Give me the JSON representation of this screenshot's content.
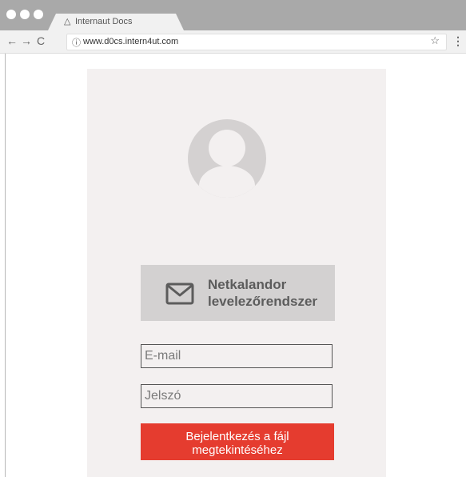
{
  "browser": {
    "tab_title": "Internaut Docs",
    "url": "www.d0cs.intern4ut.com",
    "icons": {
      "tab": "warning-triangle-icon",
      "back": "back-arrow-icon",
      "forward": "forward-arrow-icon",
      "reload": "reload-icon",
      "info": "info-icon",
      "bookmark": "star-icon",
      "menu": "kebab-menu-icon"
    }
  },
  "login": {
    "provider_label": "Netkalandor levelezőrendszer",
    "email_placeholder": "E-mail",
    "password_placeholder": "Jelszó",
    "submit_label": "Bejelentkezés a fájl megtekintéséhez"
  },
  "colors": {
    "accent": "#e53c2f",
    "card_background": "#f3f0f0",
    "titlebar": "#a9a9a9"
  }
}
